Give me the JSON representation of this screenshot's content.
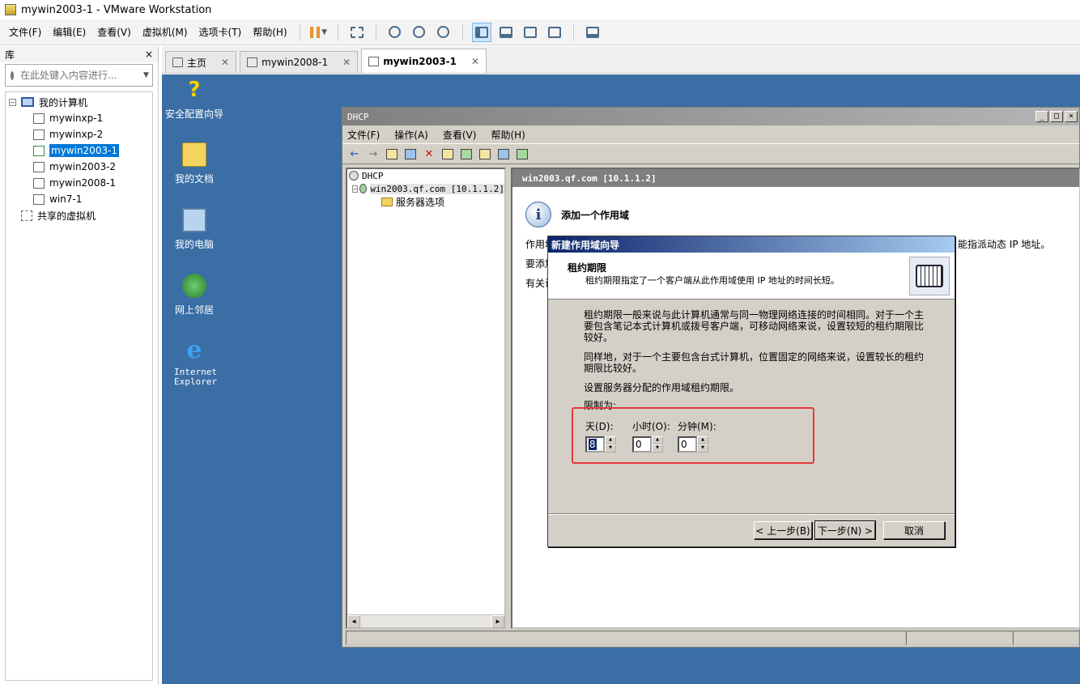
{
  "window": {
    "title": "mywin2003-1 - VMware Workstation"
  },
  "menubar": [
    "文件(F)",
    "编辑(E)",
    "查看(V)",
    "虚拟机(M)",
    "选项卡(T)",
    "帮助(H)"
  ],
  "library": {
    "title": "库",
    "close": "×",
    "search_placeholder": "在此处键入内容进行...",
    "root": "我的计算机",
    "vms": [
      "mywinxp-1",
      "mywinxp-2",
      "mywin2003-1",
      "mywin2003-2",
      "mywin2008-1",
      "win7-1"
    ],
    "selected_vm": "mywin2003-1",
    "shared": "共享的虚拟机"
  },
  "tabs": [
    {
      "label": "主页",
      "close": "✕"
    },
    {
      "label": "mywin2008-1",
      "close": "✕"
    },
    {
      "label": "mywin2003-1",
      "close": "✕"
    }
  ],
  "desktop": {
    "icons": [
      "安全配置向导",
      "我的文档",
      "我的电脑",
      "网上邻居",
      "Internet Explorer"
    ]
  },
  "dhcp": {
    "title": "DHCP",
    "window_buttons": [
      "_",
      "□",
      "×"
    ],
    "menus": [
      "文件(F)",
      "操作(A)",
      "查看(V)",
      "帮助(H)"
    ],
    "tree": {
      "root": "DHCP",
      "server": "win2003.qf.com [10.1.1.2]",
      "server_options": "服务器选项"
    },
    "right_header": "win2003.qf.com [10.1.1.2]",
    "info_title": "添加一个作用域",
    "line1_start": "作用域",
    "line1_end": "能指派动态 IP 地址。",
    "line2": "要添加",
    "line3": "有关设"
  },
  "wizard": {
    "title": "新建作用域向导",
    "header_title": "租约期限",
    "header_sub": "租约期限指定了一个客户端从此作用域使用 IP 地址的时间长短。",
    "para1": "租约期限一般来说与此计算机通常与同一物理网络连接的时间相同。对于一个主要包含笔记本式计算机或拨号客户端，可移动网络来说，设置较短的租约期限比较好。",
    "para2": "同样地，对于一个主要包含台式计算机，位置固定的网络来说，设置较长的租约期限比较好。",
    "para3": "设置服务器分配的作用域租约期限。",
    "limit_label": "限制为:",
    "days_label": "天(D):",
    "hours_label": "小时(O):",
    "minutes_label": "分钟(M):",
    "days_value": "8",
    "hours_value": "0",
    "minutes_value": "0",
    "back_button": "< 上一步(B)",
    "next_button": "下一步(N) >",
    "cancel_button": "取消"
  },
  "colors": {
    "desktop": "#3a6ea5",
    "highlight": "#e53935",
    "selection": "#0078d7"
  }
}
